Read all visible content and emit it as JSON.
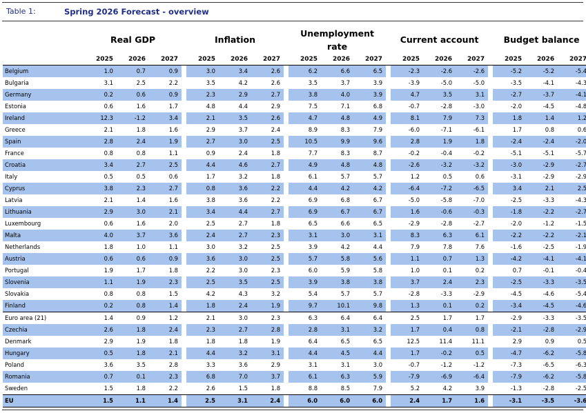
{
  "title": {
    "number": "Table 1:",
    "text": "Spring 2026 Forecast - overview"
  },
  "groups": [
    "Real GDP",
    "Inflation",
    "Unemployment rate",
    "Current account",
    "Budget balance"
  ],
  "years": [
    "2025",
    "2026",
    "2027"
  ],
  "shade_color": "#a5c3ed",
  "rows": [
    {
      "country": "Belgium",
      "shaded": true,
      "values": [
        "1.0",
        "0.7",
        "0.9",
        "3.0",
        "3.4",
        "2.6",
        "6.2",
        "6.6",
        "6.5",
        "-2.3",
        "-2.6",
        "-2.6",
        "-5.2",
        "-5.2",
        "-5.4"
      ]
    },
    {
      "country": "Bulgaria",
      "shaded": false,
      "values": [
        "3.1",
        "2.5",
        "2.2",
        "3.5",
        "4.2",
        "2.6",
        "3.5",
        "3.7",
        "3.9",
        "-3.9",
        "-5.0",
        "-5.0",
        "-3.5",
        "-4.1",
        "-4.3"
      ]
    },
    {
      "country": "Germany",
      "shaded": true,
      "values": [
        "0.2",
        "0.6",
        "0.9",
        "2.3",
        "2.9",
        "2.7",
        "3.8",
        "4.0",
        "3.9",
        "4.7",
        "3.5",
        "3.1",
        "-2.7",
        "-3.7",
        "-4.1"
      ]
    },
    {
      "country": "Estonia",
      "shaded": false,
      "values": [
        "0.6",
        "1.6",
        "1.7",
        "4.8",
        "4.4",
        "2.9",
        "7.5",
        "7.1",
        "6.8",
        "-0.7",
        "-2.8",
        "-3.0",
        "-2.0",
        "-4.5",
        "-4.8"
      ]
    },
    {
      "country": "Ireland",
      "shaded": true,
      "values": [
        "12.3",
        "-1.2",
        "3.4",
        "2.1",
        "3.5",
        "2.6",
        "4.7",
        "4.8",
        "4.9",
        "8.1",
        "7.9",
        "7.3",
        "1.8",
        "1.4",
        "1.2"
      ]
    },
    {
      "country": "Greece",
      "shaded": false,
      "values": [
        "2.1",
        "1.8",
        "1.6",
        "2.9",
        "3.7",
        "2.4",
        "8.9",
        "8.3",
        "7.9",
        "-6.0",
        "-7.1",
        "-6.1",
        "1.7",
        "0.8",
        "0.6"
      ]
    },
    {
      "country": "Spain",
      "shaded": true,
      "values": [
        "2.8",
        "2.4",
        "1.9",
        "2.7",
        "3.0",
        "2.5",
        "10.5",
        "9.9",
        "9.6",
        "2.8",
        "1.9",
        "1.8",
        "-2.4",
        "-2.4",
        "-2.0"
      ]
    },
    {
      "country": "France",
      "shaded": false,
      "values": [
        "0.8",
        "0.8",
        "1.1",
        "0.9",
        "2.4",
        "1.8",
        "7.7",
        "8.3",
        "8.7",
        "-0.2",
        "-0.4",
        "-0.2",
        "-5.1",
        "-5.1",
        "-5.7"
      ]
    },
    {
      "country": "Croatia",
      "shaded": true,
      "values": [
        "3.4",
        "2.7",
        "2.5",
        "4.4",
        "4.6",
        "2.7",
        "4.9",
        "4.8",
        "4.8",
        "-2.6",
        "-3.2",
        "-3.2",
        "-3.0",
        "-2.9",
        "-2.7"
      ]
    },
    {
      "country": "Italy",
      "shaded": false,
      "values": [
        "0.5",
        "0.5",
        "0.6",
        "1.7",
        "3.2",
        "1.8",
        "6.1",
        "5.7",
        "5.7",
        "1.2",
        "0.5",
        "0.6",
        "-3.1",
        "-2.9",
        "-2.9"
      ]
    },
    {
      "country": "Cyprus",
      "shaded": true,
      "values": [
        "3.8",
        "2.3",
        "2.7",
        "0.8",
        "3.6",
        "2.2",
        "4.4",
        "4.2",
        "4.2",
        "-6.4",
        "-7.2",
        "-6.5",
        "3.4",
        "2.1",
        "2.5"
      ]
    },
    {
      "country": "Latvia",
      "shaded": false,
      "values": [
        "2.1",
        "1.4",
        "1.6",
        "3.8",
        "3.6",
        "2.2",
        "6.9",
        "6.8",
        "6.7",
        "-5.0",
        "-5.8",
        "-7.0",
        "-2.5",
        "-3.3",
        "-4.3"
      ]
    },
    {
      "country": "Lithuania",
      "shaded": true,
      "values": [
        "2.9",
        "3.0",
        "2.1",
        "3.4",
        "4.4",
        "2.7",
        "6.9",
        "6.7",
        "6.7",
        "1.6",
        "-0.6",
        "-0.3",
        "-1.8",
        "-2.2",
        "-2.7"
      ]
    },
    {
      "country": "Luxembourg",
      "shaded": false,
      "values": [
        "0.6",
        "1.6",
        "2.0",
        "2.5",
        "2.7",
        "1.8",
        "6.5",
        "6.6",
        "6.5",
        "-2.9",
        "-2.8",
        "-2.7",
        "-2.0",
        "-1.2",
        "-1.5"
      ]
    },
    {
      "country": "Malta",
      "shaded": true,
      "values": [
        "4.0",
        "3.7",
        "3.6",
        "2.4",
        "2.7",
        "2.3",
        "3.1",
        "3.0",
        "3.1",
        "8.3",
        "6.3",
        "6.1",
        "-2.2",
        "-2.2",
        "-2.1"
      ]
    },
    {
      "country": "Netherlands",
      "shaded": false,
      "values": [
        "1.8",
        "1.0",
        "1.1",
        "3.0",
        "3.2",
        "2.5",
        "3.9",
        "4.2",
        "4.4",
        "7.9",
        "7.8",
        "7.6",
        "-1.6",
        "-2.5",
        "-1.9"
      ]
    },
    {
      "country": "Austria",
      "shaded": true,
      "values": [
        "0.6",
        "0.6",
        "0.9",
        "3.6",
        "3.0",
        "2.5",
        "5.7",
        "5.8",
        "5.6",
        "1.1",
        "0.7",
        "1.3",
        "-4.2",
        "-4.1",
        "-4.1"
      ]
    },
    {
      "country": "Portugal",
      "shaded": false,
      "values": [
        "1.9",
        "1.7",
        "1.8",
        "2.2",
        "3.0",
        "2.3",
        "6.0",
        "5.9",
        "5.8",
        "1.0",
        "0.1",
        "0.2",
        "0.7",
        "-0.1",
        "-0.4"
      ]
    },
    {
      "country": "Slovenia",
      "shaded": true,
      "values": [
        "1.1",
        "1.9",
        "2.3",
        "2.5",
        "3.5",
        "2.5",
        "3.9",
        "3.8",
        "3.8",
        "3.7",
        "2.4",
        "2.3",
        "-2.5",
        "-3.3",
        "-3.5"
      ]
    },
    {
      "country": "Slovakia",
      "shaded": false,
      "values": [
        "0.8",
        "0.8",
        "1.5",
        "4.2",
        "4.3",
        "3.2",
        "5.4",
        "5.7",
        "5.7",
        "-2.8",
        "-3.3",
        "-2.9",
        "-4.5",
        "-4.6",
        "-5.4"
      ]
    },
    {
      "country": "Finland",
      "shaded": true,
      "values": [
        "0.2",
        "0.8",
        "1.4",
        "1.8",
        "2.4",
        "1.9",
        "9.7",
        "10.1",
        "9.8",
        "1.3",
        "0.1",
        "0.2",
        "-3.4",
        "-4.5",
        "-4.6"
      ]
    },
    {
      "country": "Euro area (21)",
      "shaded": false,
      "euro_area": true,
      "values": [
        "1.4",
        "0.9",
        "1.2",
        "2.1",
        "3.0",
        "2.3",
        "6.3",
        "6.4",
        "6.4",
        "2.5",
        "1.7",
        "1.7",
        "-2.9",
        "-3.3",
        "-3.5"
      ]
    },
    {
      "country": "Czechia",
      "shaded": true,
      "values": [
        "2.6",
        "1.8",
        "2.4",
        "2.3",
        "2.7",
        "2.8",
        "2.8",
        "3.1",
        "3.2",
        "1.7",
        "0.4",
        "0.8",
        "-2.1",
        "-2.8",
        "-2.9"
      ]
    },
    {
      "country": "Denmark",
      "shaded": false,
      "values": [
        "2.9",
        "1.9",
        "1.8",
        "1.8",
        "1.8",
        "1.9",
        "6.4",
        "6.5",
        "6.5",
        "12.5",
        "11.4",
        "11.1",
        "2.9",
        "0.9",
        "0.5"
      ]
    },
    {
      "country": "Hungary",
      "shaded": true,
      "values": [
        "0.5",
        "1.8",
        "2.1",
        "4.4",
        "3.2",
        "3.1",
        "4.4",
        "4.5",
        "4.4",
        "1.7",
        "-0.2",
        "0.5",
        "-4.7",
        "-6.2",
        "-5.8"
      ]
    },
    {
      "country": "Poland",
      "shaded": false,
      "values": [
        "3.6",
        "3.5",
        "2.8",
        "3.3",
        "3.6",
        "2.9",
        "3.1",
        "3.1",
        "3.0",
        "-0.7",
        "-1.2",
        "-1.2",
        "-7.3",
        "-6.5",
        "-6.3"
      ]
    },
    {
      "country": "Romania",
      "shaded": true,
      "values": [
        "0.7",
        "0.1",
        "2.3",
        "6.8",
        "7.0",
        "3.7",
        "6.1",
        "6.3",
        "5.9",
        "-7.9",
        "-6.9",
        "-6.4",
        "-7.9",
        "-6.2",
        "-5.8"
      ]
    },
    {
      "country": "Sweden",
      "shaded": false,
      "values": [
        "1.5",
        "1.8",
        "2.2",
        "2.6",
        "1.5",
        "1.8",
        "8.8",
        "8.5",
        "7.9",
        "5.2",
        "4.2",
        "3.9",
        "-1.3",
        "-2.8",
        "-2.5"
      ]
    },
    {
      "country": "EU",
      "shaded": true,
      "eu": true,
      "values": [
        "1.5",
        "1.1",
        "1.4",
        "2.5",
        "3.1",
        "2.4",
        "6.0",
        "6.0",
        "6.0",
        "2.4",
        "1.7",
        "1.6",
        "-3.1",
        "-3.5",
        "-3.6"
      ]
    }
  ]
}
